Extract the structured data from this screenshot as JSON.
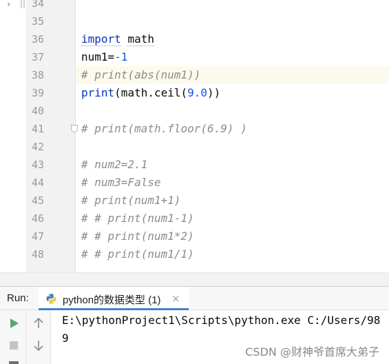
{
  "editor": {
    "line_numbers": [
      "34",
      "35",
      "36",
      "37",
      "38",
      "39",
      "40",
      "41",
      "42",
      "43",
      "44",
      "45",
      "46",
      "47",
      "48"
    ],
    "current_line": "38",
    "lines": {
      "l36_kw": "import",
      "l36_mod": "math",
      "l37_a": "num1=",
      "l37_b": "-1",
      "l38": "# print(abs(num1))",
      "l39_a": "print",
      "l39_b": "(math.ceil(",
      "l39_c": "9.0",
      "l39_d": "))",
      "l41": "# print(math.floor(6.9) )",
      "l43": "# num2=2.1",
      "l44": "# num3=False",
      "l45": "# print(num1+1)",
      "l46": "# # print(num1-1)",
      "l47": "# # print(num1*2)",
      "l48": "# # print(num1/1)"
    }
  },
  "run_panel": {
    "title": "Run:",
    "tab_label": "python的数据类型 (1)",
    "close_glyph": "×",
    "console_lines": [
      "E:\\pythonProject1\\Scripts\\python.exe C:/Users/98",
      "9"
    ]
  },
  "watermark": "CSDN @财神爷首席大弟子",
  "icons": [
    "chevron-right-icon",
    "python-file-icon",
    "run-icon",
    "stop-icon",
    "arrow-up-icon",
    "arrow-down-icon",
    "fold-icon",
    "close-icon"
  ],
  "colors": {
    "keyword": "#0033b3",
    "number": "#1750eb",
    "comment": "#8c8c8c",
    "current_line_bg": "#fcfaed",
    "run_green": "#59a869",
    "tab_underline": "#4083c9"
  }
}
